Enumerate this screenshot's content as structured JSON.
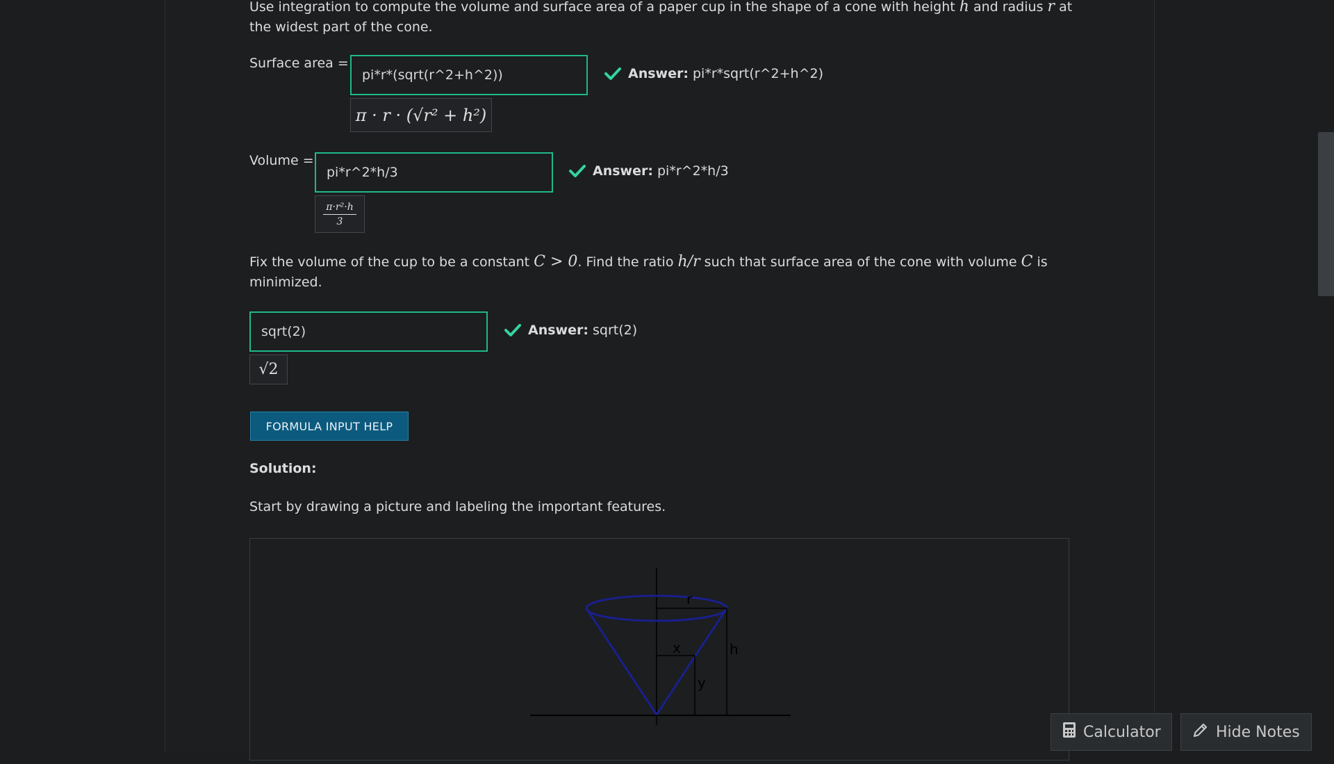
{
  "problem": {
    "intro_part1": "Use integration to compute the volume and surface area of a paper cup in the shape of a cone with height ",
    "var_h": "h",
    "intro_part2": " and radius ",
    "var_r": "r",
    "intro_part3": " at the widest part of the cone.",
    "part2_a": "Fix the volume of the cup to be a constant ",
    "part2_math1": "C > 0",
    "part2_b": ". Find the ratio ",
    "part2_math2": "h/r",
    "part2_c": " such that surface area of the cone with volume ",
    "part2_math3": "C",
    "part2_d": " is minimized."
  },
  "surface_area": {
    "label": "Surface area =",
    "input_value": "pi*r*(sqrt(r^2+h^2))",
    "preview": "π · r · (√r² + h²)",
    "answer_label": "Answer:",
    "answer_value": "pi*r*sqrt(r^2+h^2)"
  },
  "volume": {
    "label": "Volume =",
    "input_value": "pi*r^2*h/3",
    "preview_num": "π·r²·h",
    "preview_den": "3",
    "answer_label": "Answer:",
    "answer_value": "pi*r^2*h/3"
  },
  "ratio": {
    "input_value": "sqrt(2)",
    "preview": "√2",
    "answer_label": "Answer:",
    "answer_value": "sqrt(2)"
  },
  "formula_help_label": "FORMULA INPUT HELP",
  "solution": {
    "title": "Solution:",
    "text": "Start by drawing a picture and labeling the important features.",
    "figure_labels": {
      "r": "r",
      "h": "h",
      "x": "x",
      "y": "y"
    }
  },
  "toolbar": {
    "calculator_label": "Calculator",
    "hide_notes_label": "Hide Notes"
  },
  "colors": {
    "correct": "#34d4a0",
    "input_border": "#1fb88b",
    "button_bg": "#0c5a7e",
    "cone_stroke": "#1a1f8c"
  },
  "icons": {
    "check": "check-icon",
    "calculator": "calculator-icon",
    "pencil": "pencil-icon"
  }
}
